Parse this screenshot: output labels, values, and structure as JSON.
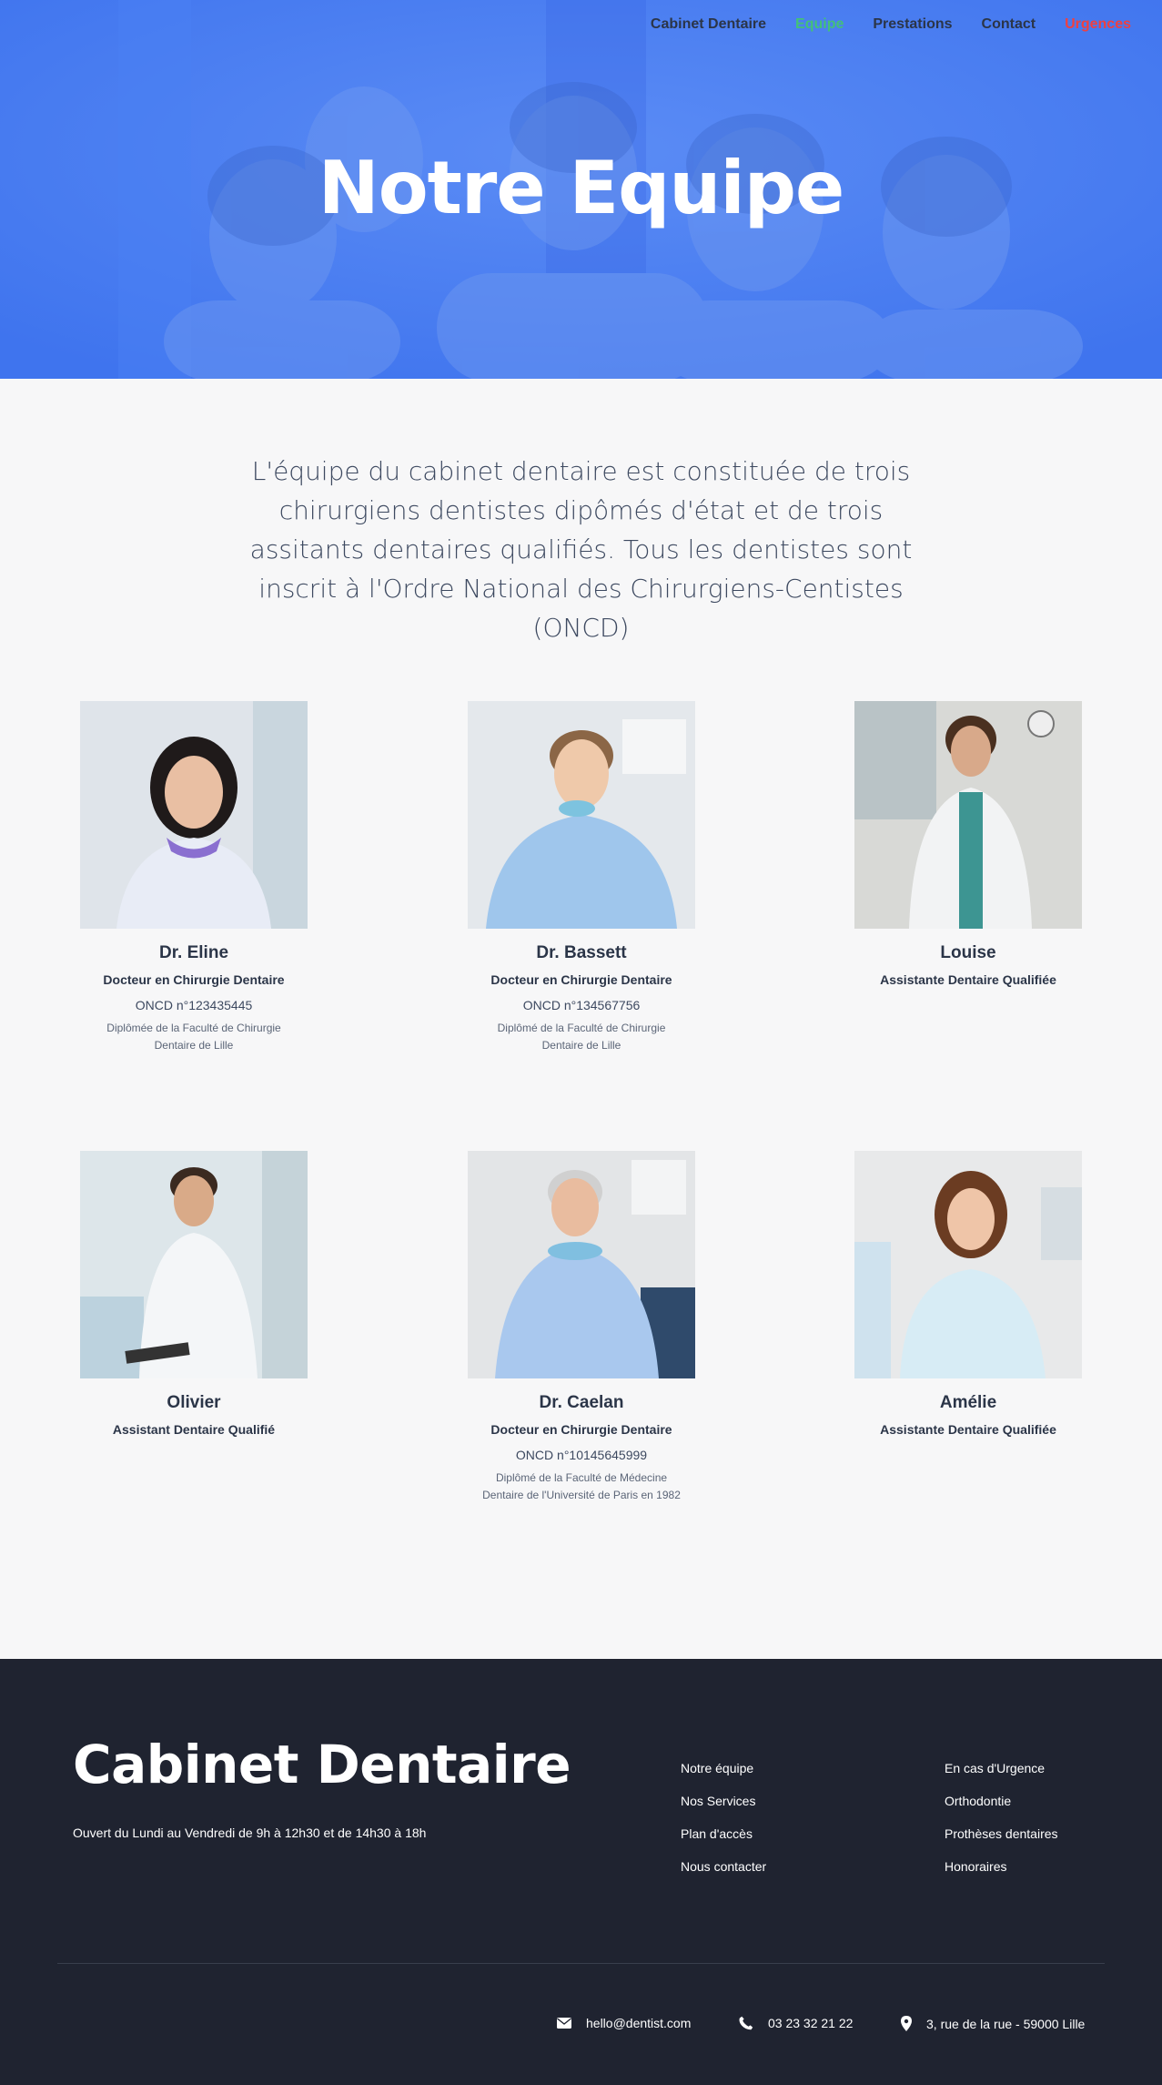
{
  "nav": {
    "items": [
      {
        "label": "Cabinet Dentaire",
        "state": "default"
      },
      {
        "label": "Equipe",
        "state": "active"
      },
      {
        "label": "Prestations",
        "state": "default"
      },
      {
        "label": "Contact",
        "state": "default"
      },
      {
        "label": "Urgences",
        "state": "urgent"
      }
    ]
  },
  "hero": {
    "title": "Notre Equipe",
    "overlay_color": "#4a7ff3"
  },
  "intro": {
    "text": "L'équipe du cabinet dentaire est constituée de trois chirurgiens dentistes dipômés d'état et de trois assitants dentaires qualifiés. Tous les dentistes sont inscrit à l'Ordre National des Chirurgiens-Centistes (ONCD)"
  },
  "team": [
    {
      "name": "Dr. Eline",
      "role": "Docteur en Chirurgie Dentaire",
      "oncd": "ONCD n°123435445",
      "diploma": "Diplômée de la Faculté de Chirurgie Dentaire de Lille"
    },
    {
      "name": "Dr. Bassett",
      "role": "Docteur en Chirurgie Dentaire",
      "oncd": "ONCD n°134567756",
      "diploma": "Diplômé de la Faculté de Chirurgie Dentaire de Lille"
    },
    {
      "name": "Louise",
      "role": "Assistante Dentaire Qualifiée"
    },
    {
      "name": "Olivier",
      "role": "Assistant Dentaire Qualifié"
    },
    {
      "name": "Dr. Caelan",
      "role": "Docteur en Chirurgie Dentaire",
      "oncd": "ONCD n°10145645999",
      "diploma": "Diplômé de la Faculté de Médecine Dentaire de l'Université de Paris en 1982"
    },
    {
      "name": "Amélie",
      "role": "Assistante Dentaire Qualifiée"
    }
  ],
  "footer": {
    "brand": "Cabinet Dentaire",
    "hours": "Ouvert du Lundi au Vendredi de 9h à 12h30 et de 14h30 à 18h",
    "col1": [
      "Notre équipe",
      "Nos Services",
      "Plan d'accès",
      "Nous contacter"
    ],
    "col2": [
      "En cas d'Urgence",
      "Orthodontie",
      "Prothèses dentaires",
      "Honoraires"
    ],
    "email": "hello@dentist.com",
    "phone": "03 23 32 21 22",
    "address": "3, rue de la rue - 59000 Lille"
  },
  "colors": {
    "accent_green": "#43c07a",
    "urgent_red": "#ef4040",
    "footer_bg": "#1f2330",
    "text_dark": "#2b3548"
  }
}
